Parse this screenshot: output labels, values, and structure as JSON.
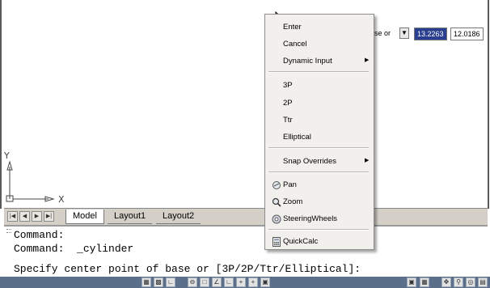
{
  "viewport": {
    "axis_y_label": "Y",
    "axis_x_label": "X"
  },
  "dynamic_input": {
    "prompt_fragment": "se or",
    "field_value": "13.2263",
    "second_value": "12.0186",
    "arrow_icon": "down-arrow-icon"
  },
  "layout_tabs": {
    "nav_buttons": [
      "first-tab-icon",
      "previous-tab-icon",
      "next-tab-icon",
      "last-tab-icon"
    ],
    "tabs": [
      "Model",
      "Layout1",
      "Layout2"
    ]
  },
  "command_line": {
    "lines": [
      "Command:",
      "Command:  _cylinder",
      "Specify center point of base or [3P/2P/Ttr/Elliptical]:"
    ]
  },
  "context_menu": {
    "items": {
      "enter": "Enter",
      "cancel": "Cancel",
      "dynamic_input": "Dynamic Input",
      "three_p": "3P",
      "two_p": "2P",
      "ttr": "Ttr",
      "elliptical": "Elliptical",
      "snap_overrides": "Snap Overrides",
      "pan": "Pan",
      "zoom": "Zoom",
      "steering_wheels": "SteeringWheels",
      "quickcalc": "QuickCalc"
    },
    "submenu_arrow": "submenu-arrow-icon"
  },
  "colors": {
    "status_bar": "#5b6e8a",
    "selected_field": "#2a3f8f",
    "menu_background": "#f2f0ec"
  }
}
